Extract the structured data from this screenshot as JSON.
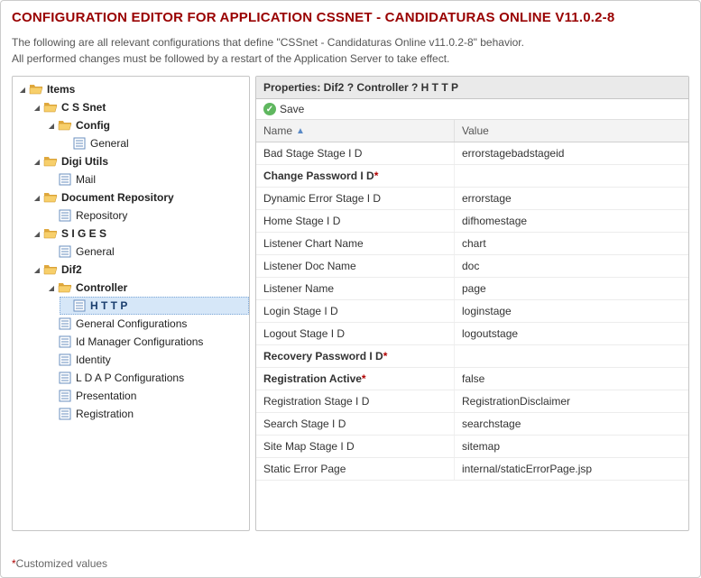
{
  "page": {
    "title": "CONFIGURATION EDITOR FOR APPLICATION CSSNET - CANDIDATURAS ONLINE V11.0.2-8",
    "subtitle_line1": "The following are all relevant configurations that define \"CSSnet - Candidaturas Online v11.0.2-8\" behavior.",
    "subtitle_line2": "All performed changes must be followed by a restart of the Application Server to take effect.",
    "footnote": "Customized values"
  },
  "tree": {
    "root": "Items",
    "cssnet": "C S Snet",
    "config": "Config",
    "general_cssnet": "General",
    "digiutils": "Digi Utils",
    "mail": "Mail",
    "docrepo": "Document Repository",
    "repository": "Repository",
    "siges": "S I G E S",
    "general_siges": "General",
    "dif2": "Dif2",
    "controller": "Controller",
    "http": "H T T P",
    "general_conf": "General Configurations",
    "idmgr": "Id Manager Configurations",
    "identity": "Identity",
    "ldap": "L D A P Configurations",
    "presentation": "Presentation",
    "registration": "Registration"
  },
  "toggle": {
    "expanded": "◢",
    "collapsed": "▸"
  },
  "properties": {
    "header": "Properties: Dif2 ? Controller ? H T T P",
    "save": "Save",
    "col_name": "Name",
    "col_value": "Value",
    "rows": [
      {
        "name": "Bad Stage Stage I D",
        "value": "errorstagebadstageid",
        "custom": false
      },
      {
        "name": "Change Password I D",
        "value": "",
        "custom": true
      },
      {
        "name": "Dynamic Error Stage I D",
        "value": "errorstage",
        "custom": false
      },
      {
        "name": "Home Stage I D",
        "value": "difhomestage",
        "custom": false
      },
      {
        "name": "Listener Chart Name",
        "value": "chart",
        "custom": false
      },
      {
        "name": "Listener Doc Name",
        "value": "doc",
        "custom": false
      },
      {
        "name": "Listener Name",
        "value": "page",
        "custom": false
      },
      {
        "name": "Login Stage I D",
        "value": "loginstage",
        "custom": false
      },
      {
        "name": "Logout Stage I D",
        "value": "logoutstage",
        "custom": false
      },
      {
        "name": "Recovery Password I D",
        "value": "",
        "custom": true
      },
      {
        "name": "Registration Active",
        "value": "false",
        "custom": true
      },
      {
        "name": "Registration Stage I D",
        "value": "RegistrationDisclaimer",
        "custom": false
      },
      {
        "name": "Search Stage I D",
        "value": "searchstage",
        "custom": false
      },
      {
        "name": "Site Map Stage I D",
        "value": "sitemap",
        "custom": false
      },
      {
        "name": "Static Error Page",
        "value": "internal/staticErrorPage.jsp",
        "custom": false
      }
    ]
  }
}
